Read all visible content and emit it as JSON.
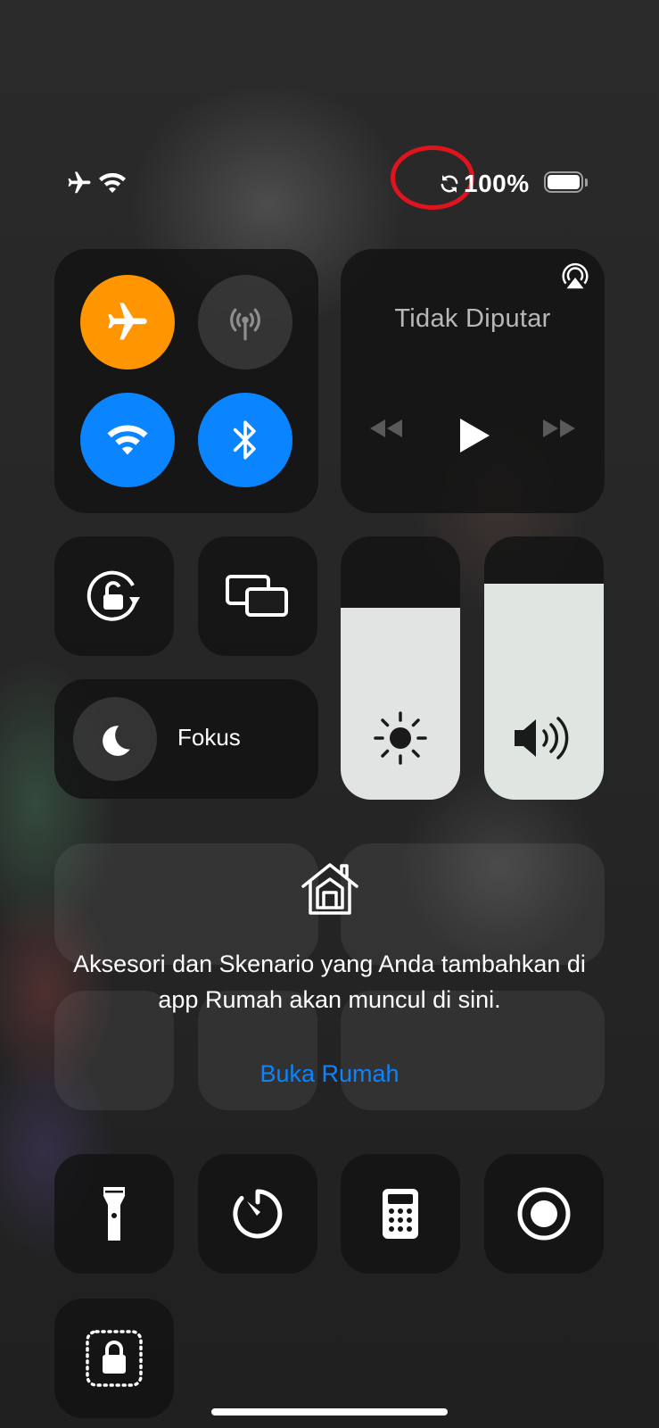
{
  "status_bar": {
    "battery_percent": "100%",
    "battery_level": 1.0,
    "icons": [
      "airplane-icon",
      "wifi-icon",
      "rotation-lock-sync-icon",
      "battery-icon"
    ]
  },
  "connectivity": {
    "airplane_mode": {
      "icon": "airplane-icon",
      "state": "on",
      "color": "#FF9500"
    },
    "cellular": {
      "icon": "cellular-antenna-icon",
      "state": "off"
    },
    "wifi": {
      "icon": "wifi-icon",
      "state": "on",
      "color": "#0A84FF"
    },
    "bluetooth": {
      "icon": "bluetooth-icon",
      "state": "on",
      "color": "#0A84FF"
    }
  },
  "media": {
    "status": "Tidak Diputar",
    "icons": [
      "airplay-icon",
      "rewind-icon",
      "play-icon",
      "fast-forward-icon"
    ]
  },
  "focus": {
    "label": "Fokus",
    "icon": "moon-icon"
  },
  "sliders": {
    "brightness": {
      "level_percent": 73,
      "icon": "sun-icon"
    },
    "volume": {
      "level_percent": 82,
      "icon": "speaker-icon"
    }
  },
  "home": {
    "message": "Aksesori dan Skenario yang Anda tambahkan di app Rumah akan muncul di sini.",
    "link": "Buka Rumah",
    "link_color": "#0A84FF",
    "icon": "home-icon"
  },
  "shortcuts": [
    "flashlight-icon",
    "timer-icon",
    "calculator-icon",
    "screen-record-icon",
    "screen-lock-icon"
  ],
  "annotation": {
    "color": "#E0141E"
  }
}
